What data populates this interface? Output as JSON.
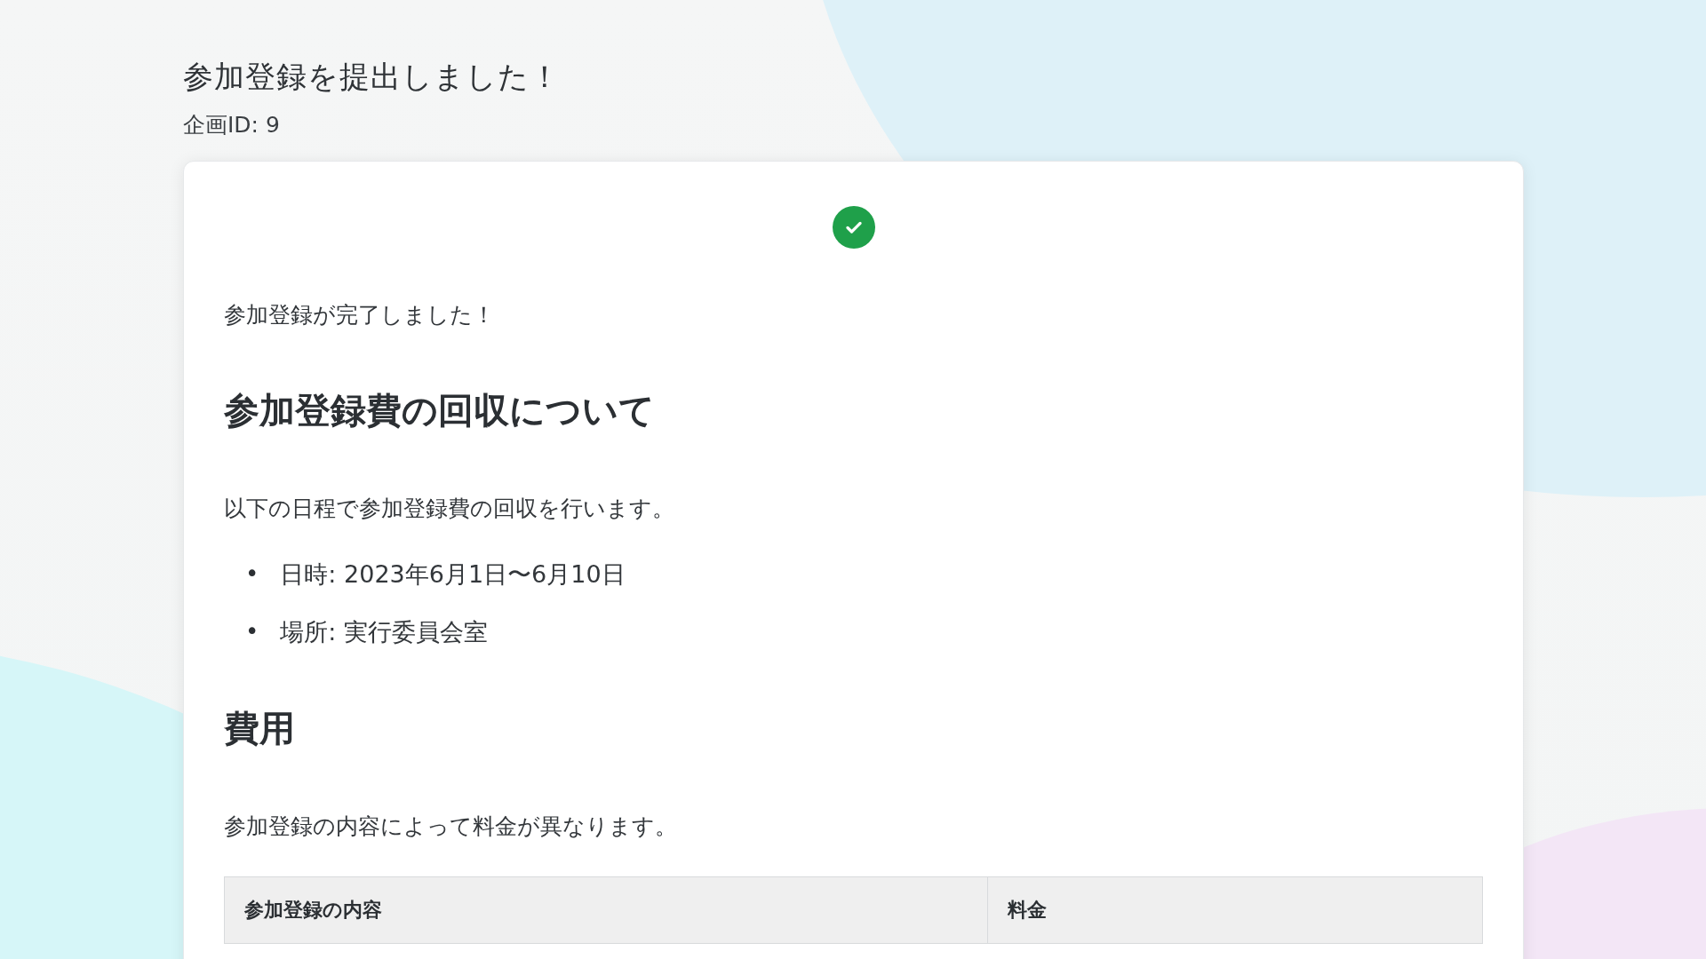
{
  "header": {
    "title": "参加登録を提出しました！",
    "subtitle": "企画ID: 9"
  },
  "card": {
    "completed": true,
    "message": "参加登録が完了しました！",
    "sections": [
      {
        "heading": "参加登録費の回収について",
        "paragraph": "以下の日程で参加登録費の回収を行います。",
        "bullets": [
          {
            "marker": "•",
            "text": "日時: 2023年6月1日〜6月10日"
          },
          {
            "marker": "•",
            "text": "場所: 実行委員会室"
          }
        ]
      },
      {
        "heading": "費用",
        "paragraph": "参加登録の内容によって料金が異なります。",
        "table": {
          "columns": [
            "参加登録の内容",
            "料金"
          ]
        }
      }
    ]
  }
}
